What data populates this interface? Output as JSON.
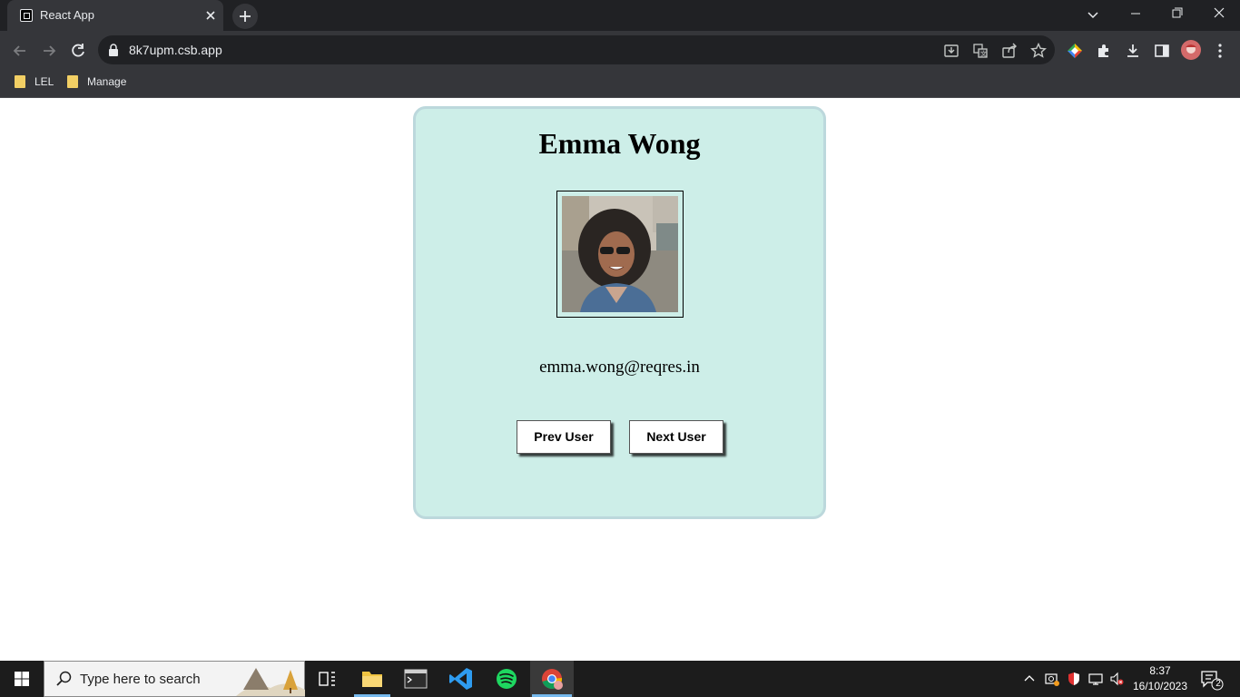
{
  "browser": {
    "tab_title": "React App",
    "url": "8k7upm.csb.app",
    "bookmarks": [
      {
        "label": "LEL"
      },
      {
        "label": "Manage"
      }
    ]
  },
  "app": {
    "user": {
      "name": "Emma Wong",
      "email": "emma.wong@reqres.in"
    },
    "buttons": {
      "prev": "Prev User",
      "next": "Next User"
    },
    "colors": {
      "card_background": "#cdeee8",
      "card_border": "#bcd8dc"
    }
  },
  "taskbar": {
    "search_placeholder": "Type here to search",
    "apps": [
      "task-view-icon",
      "file-explorer-icon",
      "terminal-icon",
      "vscode-icon",
      "spotify-icon",
      "chrome-icon"
    ],
    "time": "8:37",
    "date": "16/10/2023",
    "notification_count": "2"
  }
}
